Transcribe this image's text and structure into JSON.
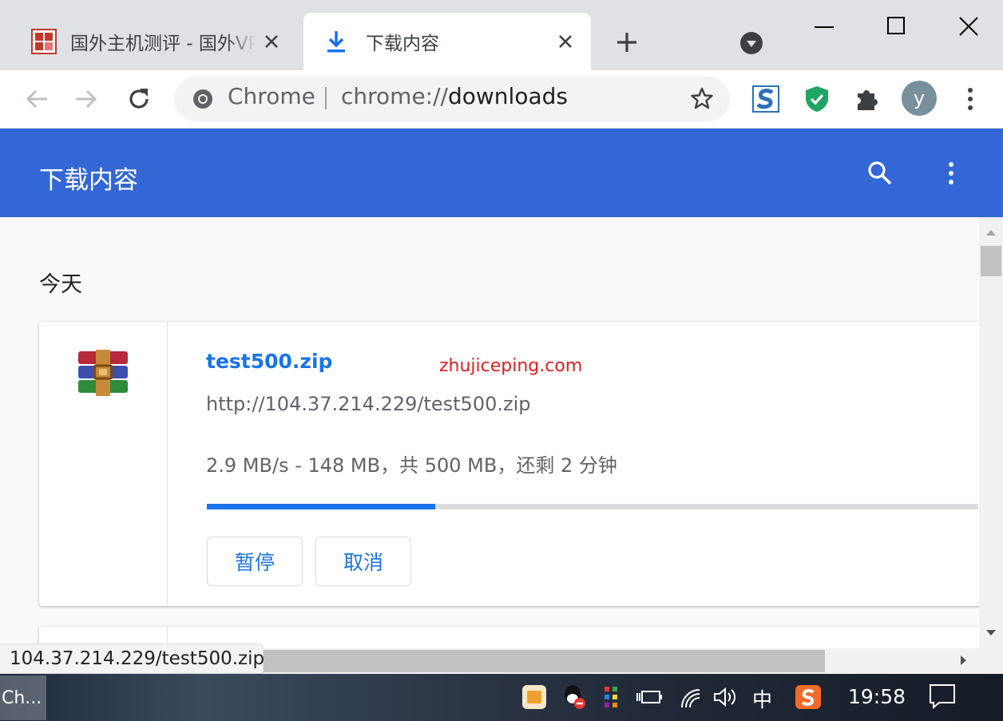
{
  "tabs": [
    {
      "title": "国外主机测评 - 国外VPS",
      "active": false
    },
    {
      "title": "下载内容",
      "active": true
    }
  ],
  "omnibox": {
    "site_label": "Chrome",
    "url_prefix": "chrome://",
    "url_host": "downloads"
  },
  "profile_initial": "y",
  "header": {
    "title": "下载内容"
  },
  "section_label": "今天",
  "download": {
    "filename": "test500.zip",
    "url": "http://104.37.214.229/test500.zip",
    "progress_text": "2.9 MB/s - 148 MB，共 500 MB，还剩 2 分钟",
    "progress_fraction": 0.296,
    "pause_label": "暂停",
    "cancel_label": "取消"
  },
  "watermark": "zhujiceping.com",
  "status_url": "104.37.214.229/test500.zip",
  "taskbar": {
    "chrome_label": "Ch...",
    "ime": "中",
    "time": "19:58"
  },
  "colors": {
    "header": "#3367d6",
    "accent": "#1a73e8"
  },
  "icons": [
    "site-favicon",
    "download-icon",
    "close-icon",
    "new-tab-icon",
    "tab-search-icon",
    "back-arrow-icon",
    "forward-arrow-icon",
    "reload-icon",
    "chrome-icon",
    "star-icon",
    "extension-s-icon",
    "shield-check-icon",
    "puzzle-icon",
    "kebab-menu-icon",
    "search-icon",
    "winrar-archive-icon"
  ]
}
